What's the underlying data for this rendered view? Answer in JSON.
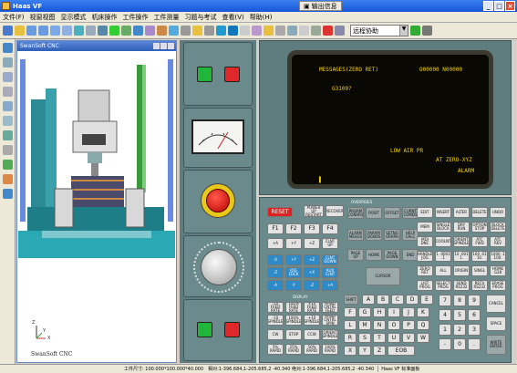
{
  "window": {
    "title": "Haas VF",
    "output_window_label": "输出信息"
  },
  "menu": [
    "文件(F)",
    "视窗视图",
    "显示模式",
    "机床操作",
    "工件操作",
    "工件测量",
    "习题与考试",
    "查看(V)",
    "帮助(H)"
  ],
  "toolbar": {
    "remote_mode": "远程协助"
  },
  "sim": {
    "title": "SwanSoft CNC",
    "footer": "SwanSoft CNC",
    "axis_x": "X",
    "axis_y": "Y",
    "axis_z": "Z"
  },
  "screen": {
    "line1": "MESSAGES(ZERO RET)",
    "prog": "O00000 N00000",
    "line2": "G3100?",
    "line3": "LOW AIR PR",
    "line4": "AT ZERO-XYZ",
    "line5": "ALARM",
    "cursor": "▌"
  },
  "keys": {
    "reset": "RESET",
    "power_up": "POWER UP RESTART",
    "recover": "RECOVER",
    "f1": "F1",
    "f2": "F2",
    "f3": "F3",
    "f4": "F4",
    "overrides_title": "OVERRIDES",
    "display_title": "DISPLAY",
    "shift": "SHIFT",
    "eob": "EOB",
    "overrides": [
      "-10 FEED RATE",
      "100% FEED RATE",
      "+10 FEED RATE",
      "HAND CNTRL FEED",
      "-10 SPINDLE",
      "100% SPINDLE",
      "+10 SPINDLE",
      "HAND CNTRL SPIN",
      "5% RAPID",
      "25% RAPID",
      "50% RAPID",
      "100% RAPID"
    ],
    "display": [
      "PRGRM CONVRS",
      "POSIT",
      "OFFSET",
      "CURNT COMDS",
      "ALARM MESGS",
      "PARAM DGNOS",
      "SETNG GRAPH",
      "HELP CALC"
    ],
    "jog": [
      "+A",
      "+Y",
      "+Z",
      "-X",
      "JOG LOCK",
      "+X",
      "-Z",
      "-Y",
      "-A",
      "CLNT UP",
      "CLNT DOWN",
      "AUX CLNT"
    ],
    "spindle": [
      "CW",
      "STOP",
      "CCW",
      "ORIENT SPINDLE",
      "ATC FWD",
      "ATC REV"
    ],
    "edit": [
      "EDIT",
      "INSERT",
      "ALTER",
      "DELETE",
      "UNDO",
      "MEM",
      "SINGLE BLOCK",
      "DRY RUN",
      "OPTION STOP",
      "BLOCK DELETE",
      "MDI DNC",
      "COOLNT",
      "ORIENT SPINDLE",
      "ATC FWD",
      "ATC REV",
      "HANDLE JOG",
      "1 .0001 .1",
      "10 .001 1.",
      "100 .01 10.",
      "1000 .1 100.",
      "ZERO RET",
      "ALL",
      "ORIGIN",
      "SINGL",
      "HOME G28",
      "LIST PROG",
      "SELECT PROG",
      "SEND RS232",
      "RECV RS232",
      "ERASE PROG"
    ],
    "num_left": [
      "PAGE UP",
      "HOME",
      "PAGE DOWN",
      "END",
      "CURSOR"
    ],
    "letters": [
      "A",
      "B",
      "C",
      "D",
      "E",
      "F",
      "G",
      "H",
      "I",
      "J",
      "K",
      "L",
      "M",
      "N",
      "O",
      "P",
      "Q",
      "R",
      "S",
      "T",
      "U",
      "V",
      "W",
      "X",
      "Y",
      "Z"
    ],
    "digits": [
      "7",
      "8",
      "9",
      "4",
      "5",
      "6",
      "1",
      "2",
      "3",
      "-",
      "0",
      "."
    ],
    "bottom": [
      "CANCEL",
      "SPACE",
      "WRITE ENTER"
    ]
  },
  "status": {
    "workpiece": "工件尺寸: 100.000*100.000*40.000",
    "coords": "相对:1-396.684,1-205.685,2 -40.340 绝对:1-396.684,1-205.685,2 -40.340",
    "machine": "Haas VF 标准面板"
  }
}
